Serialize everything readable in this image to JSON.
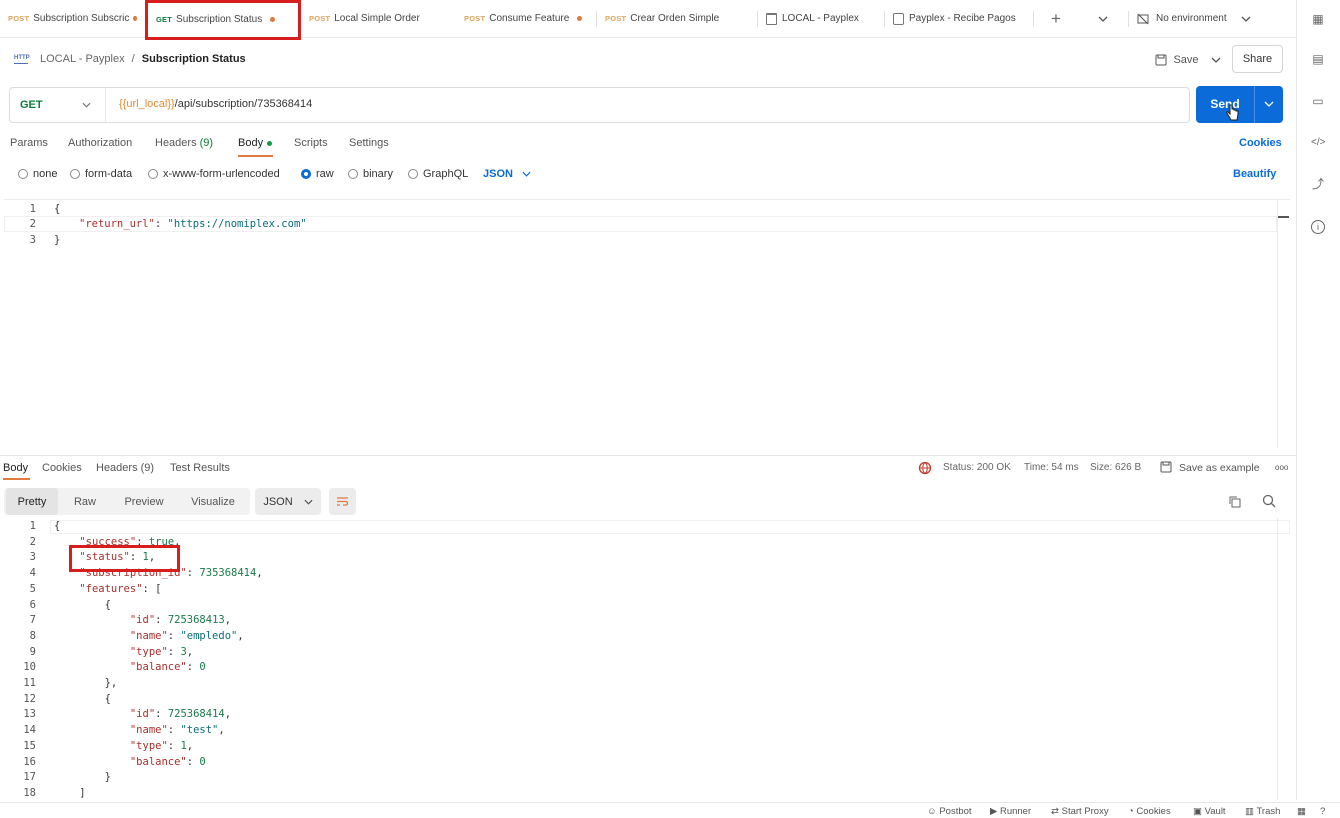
{
  "tabs": [
    {
      "method": "POST",
      "label": "Subscription Subscric",
      "dirty": true
    },
    {
      "method": "GET",
      "label": "Subscription Status",
      "dirty": true,
      "active": true
    },
    {
      "method": "POST",
      "label": "Local Simple Order",
      "dirty": false
    },
    {
      "method": "POST",
      "label": "Consume Feature",
      "dirty": true
    },
    {
      "method": "POST",
      "label": "Crear Orden Simple",
      "dirty": false
    },
    {
      "icon": "collection-icon",
      "label": "LOCAL - Payplex"
    },
    {
      "icon": "document-icon",
      "label": "Payplex - Recibe Pagos"
    }
  ],
  "environment": "No environment",
  "breadcrumb": {
    "collection": "LOCAL - Payplex",
    "separator": "/",
    "request": "Subscription Status",
    "badge": "HTTP"
  },
  "actions": {
    "save": "Save",
    "share": "Share"
  },
  "request": {
    "method": "GET",
    "url_variable": "{{url_local}}",
    "url_path": "/api/subscription/735368414",
    "send": "Send"
  },
  "request_tabs": {
    "params": "Params",
    "authorization": "Authorization",
    "headers": "Headers",
    "headers_count": "(9)",
    "body": "Body",
    "scripts": "Scripts",
    "settings": "Settings",
    "cookies": "Cookies"
  },
  "body_types": {
    "none": "none",
    "form_data": "form-data",
    "urlencoded": "x-www-form-urlencoded",
    "raw": "raw",
    "binary": "binary",
    "graphql": "GraphQL",
    "format": "JSON",
    "beautify": "Beautify"
  },
  "request_body": {
    "line_numbers": [
      "1",
      "2",
      "3"
    ],
    "open": "{",
    "key": "\"return_url\"",
    "colon": ": ",
    "value": "\"https://nomiplex.com\"",
    "close": "}"
  },
  "response_tabs": {
    "body": "Body",
    "cookies": "Cookies",
    "headers": "Headers (9)",
    "tests": "Test Results"
  },
  "response_meta": {
    "status": "Status: 200 OK",
    "time": "Time: 54 ms",
    "size": "Size: 626 B",
    "save_example": "Save as example",
    "more": "ooo"
  },
  "response_views": {
    "pretty": "Pretty",
    "raw": "Raw",
    "preview": "Preview",
    "visualize": "Visualize",
    "format": "JSON"
  },
  "response_lines": [
    {
      "n": "1",
      "text": "{"
    },
    {
      "n": "2",
      "text": "    \"success\": true,"
    },
    {
      "n": "3",
      "text": "    \"status\": 1,"
    },
    {
      "n": "4",
      "text": "    \"subscription_id\": 735368414,"
    },
    {
      "n": "5",
      "text": "    \"features\": ["
    },
    {
      "n": "6",
      "text": "        {"
    },
    {
      "n": "7",
      "text": "            \"id\": 725368413,"
    },
    {
      "n": "8",
      "text": "            \"name\": \"empledo\","
    },
    {
      "n": "9",
      "text": "            \"type\": 3,"
    },
    {
      "n": "10",
      "text": "            \"balance\": 0"
    },
    {
      "n": "11",
      "text": "        },"
    },
    {
      "n": "12",
      "text": "        {"
    },
    {
      "n": "13",
      "text": "            \"id\": 725368414,"
    },
    {
      "n": "14",
      "text": "            \"name\": \"test\","
    },
    {
      "n": "15",
      "text": "            \"type\": 1,"
    },
    {
      "n": "16",
      "text": "            \"balance\": 0"
    },
    {
      "n": "17",
      "text": "        }"
    },
    {
      "n": "18",
      "text": "    ]"
    }
  ],
  "statusbar": {
    "postbot": "Postbot",
    "runner": "Runner",
    "proxy": "Start Proxy",
    "cookies": "Cookies",
    "vault": "Vault",
    "trash": "Trash"
  },
  "colors": {
    "accent": "#0b6bd8",
    "highlight": "#d81d1d",
    "dirty_dot": "#e07a3c"
  }
}
